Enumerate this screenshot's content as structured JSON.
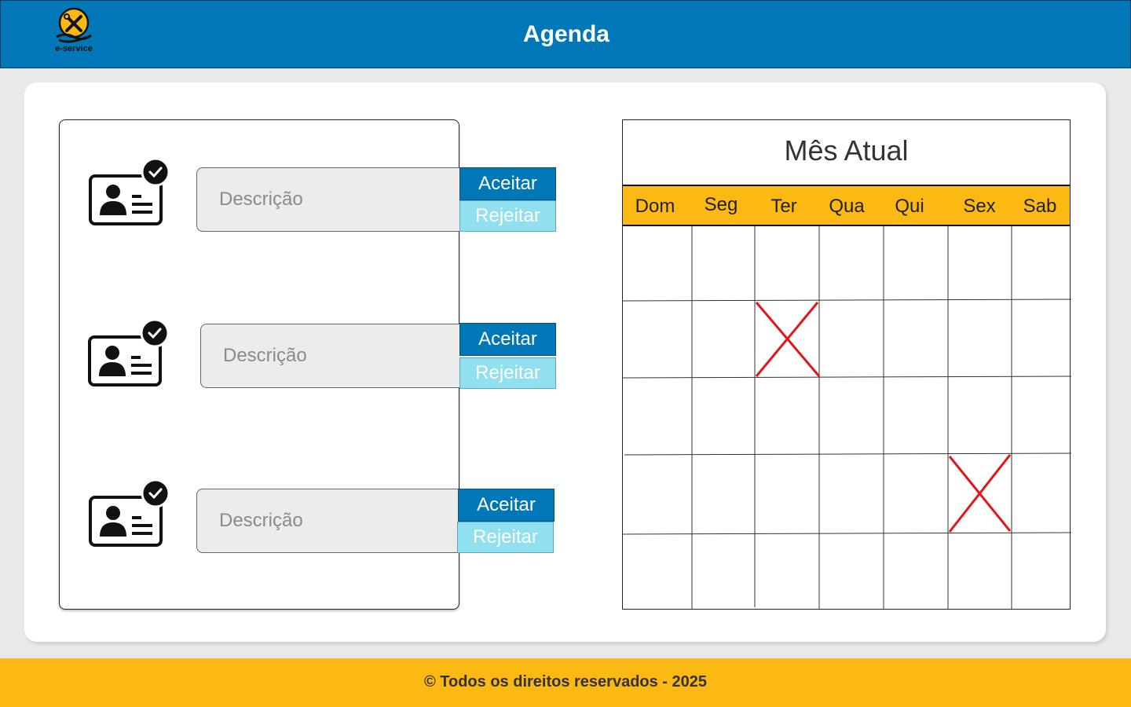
{
  "header": {
    "title": "Agenda",
    "logo_text": "e-service",
    "logo_icon": "tools-hand-icon"
  },
  "requests": [
    {
      "description_placeholder": "Descrição",
      "accept_label": "Aceitar",
      "reject_label": "Rejeitar",
      "icon": "id-card-verified-icon"
    },
    {
      "description_placeholder": "Descrição",
      "accept_label": "Aceitar",
      "reject_label": "Rejeitar",
      "icon": "id-card-verified-icon"
    },
    {
      "description_placeholder": "Descrição",
      "accept_label": "Aceitar",
      "reject_label": "Rejeitar",
      "icon": "id-card-verified-icon"
    }
  ],
  "calendar": {
    "title": "Mês Atual",
    "days": [
      "Dom",
      "Seg",
      "Ter",
      "Qua",
      "Qui",
      "Sex",
      "Sab"
    ],
    "rows": 5,
    "marked_cells": [
      {
        "row": 2,
        "day": "Ter"
      },
      {
        "row": 4,
        "day": "Sex"
      }
    ]
  },
  "footer": {
    "text": "© Todos os direitos reservados - 2025"
  },
  "colors": {
    "primary": "#0077b6",
    "accent": "#fdb913",
    "light_blue": "#90e0ef",
    "mark_red": "#e3151a"
  }
}
